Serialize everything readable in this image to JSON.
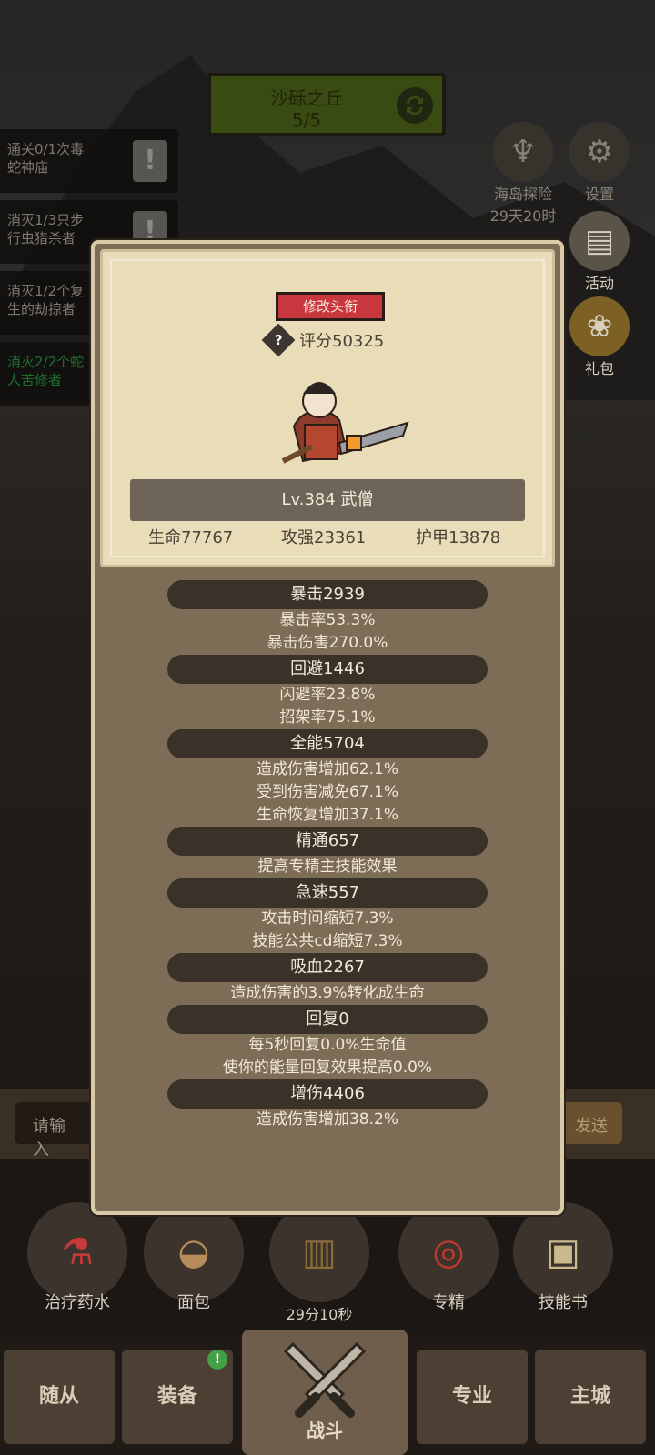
{
  "level": {
    "name": "沙砾之丘",
    "progress": "5/5"
  },
  "quests": [
    {
      "line1": "通关0/1次毒",
      "line2": "蛇神庙",
      "done": false
    },
    {
      "line1": "消灭1/3只步",
      "line2": "行虫猎杀者",
      "done": false
    },
    {
      "line1": "消灭1/2个复",
      "line2": "生的劫掠者",
      "done": false
    },
    {
      "line1": "消灭2/2个蛇",
      "line2": "人苦修者",
      "done": true
    }
  ],
  "side": {
    "island": {
      "label": "海岛探险",
      "timer": "29天20时"
    },
    "settings": {
      "label": "设置"
    },
    "event": {
      "label": "活动"
    },
    "gift": {
      "label": "礼包"
    }
  },
  "character": {
    "title_button": "修改头衔",
    "score": "评分50325",
    "level_name": "Lv.384 武僧",
    "hp": "生命77767",
    "attack": "攻强23361",
    "armor": "护甲13878"
  },
  "stats": [
    {
      "head": "暴击2939",
      "lines": [
        "暴击率53.3%",
        "暴击伤害270.0%"
      ]
    },
    {
      "head": "回避1446",
      "lines": [
        "闪避率23.8%",
        "招架率75.1%"
      ]
    },
    {
      "head": "全能5704",
      "lines": [
        "造成伤害增加62.1%",
        "受到伤害减免67.1%",
        "生命恢复增加37.1%"
      ]
    },
    {
      "head": "精通657",
      "lines": [
        "提高专精主技能效果"
      ]
    },
    {
      "head": "急速557",
      "lines": [
        "攻击时间缩短7.3%",
        "技能公共cd缩短7.3%"
      ]
    },
    {
      "head": "吸血2267",
      "lines": [
        "造成伤害的3.9%转化成生命"
      ]
    },
    {
      "head": "回复0",
      "lines": [
        "每5秒回复0.0%生命值",
        "使你的能量回复效果提高0.0%"
      ]
    },
    {
      "head": "增伤4406",
      "lines": [
        "造成伤害增加38.2%"
      ]
    }
  ],
  "chat": {
    "placeholder": "请输入",
    "send": "发送"
  },
  "actions": {
    "potion": "治疗药水",
    "bread": "面包",
    "chest_timer": "29分10秒",
    "spec": "专精",
    "skillbook": "技能书"
  },
  "nav": {
    "followers": "随从",
    "equipment": "装备",
    "equipment_badge": "!",
    "battle": "战斗",
    "profession": "专业",
    "city": "主城"
  },
  "colors": {
    "accent_red": "#c8373d",
    "quest_done": "#35b24b",
    "panel": "#7e6d56",
    "card": "#e9dcb8"
  }
}
